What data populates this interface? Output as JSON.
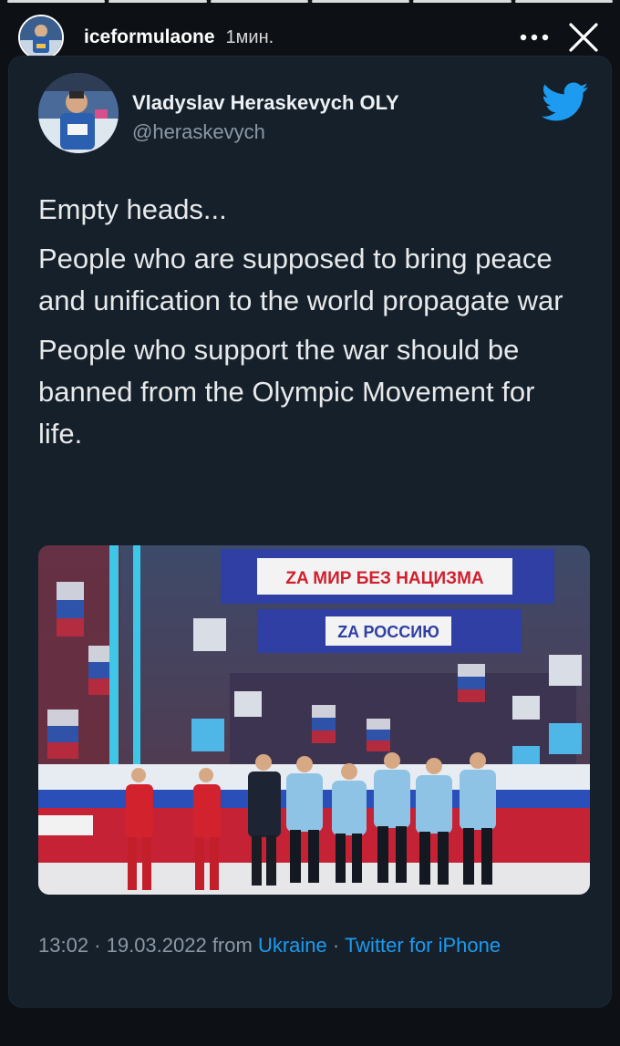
{
  "story": {
    "username": "iceformulaone",
    "time": "1мин.",
    "more_icon": "more-horizontal-icon",
    "close_icon": "close-icon",
    "segments": 6,
    "active_segments": 6
  },
  "tweet": {
    "name": "Vladyslav Heraskevych OLY",
    "handle": "@heraskevych",
    "paragraphs": [
      "Empty heads...",
      "People who are supposed to bring peace and unification to the world propagate war",
      "People who support the war should be banned from the Olympic Movement for life."
    ],
    "photo": {
      "banner_top": "ZA МИР БЕЗ НАЦИЗМА",
      "banner_bottom": "ZA РОССИЮ"
    },
    "meta": {
      "time_date": "13:02 · 19.03.2022 from",
      "location": "Ukraine",
      "separator": "·",
      "source": "Twitter for iPhone"
    }
  },
  "colors": {
    "background": "#0d1116",
    "card": "#15202b",
    "link": "#1d9bf0",
    "twitter_blue": "#1d9bf0",
    "muted": "#8b98a5"
  }
}
